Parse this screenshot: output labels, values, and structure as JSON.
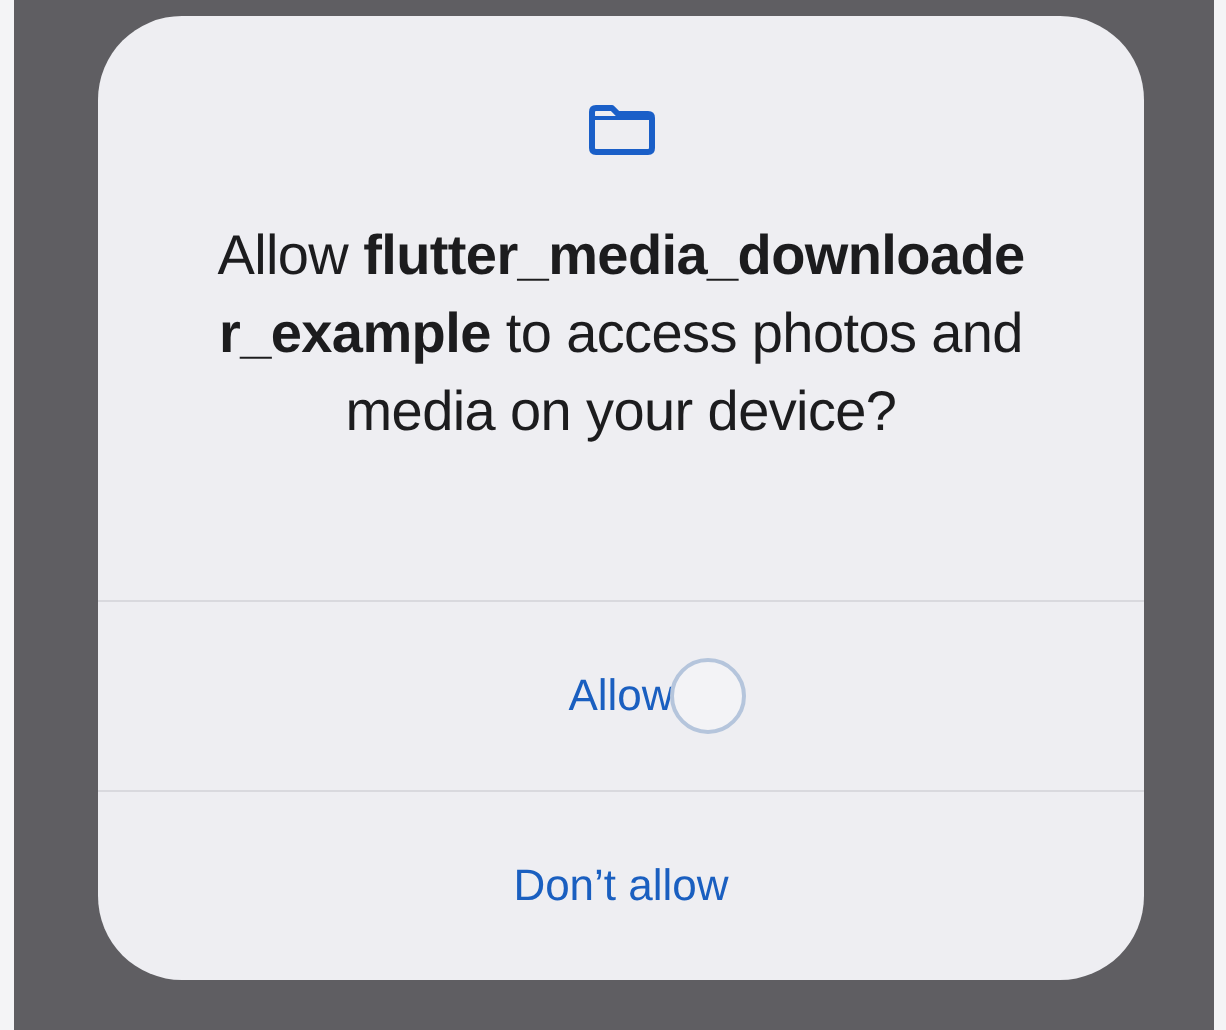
{
  "dialog": {
    "message": "Allow **flutter_media_downloader_example** to access photos and media on your device?",
    "buttons": [
      {
        "label": "Allow"
      },
      {
        "label": "Don’t allow"
      }
    ]
  }
}
